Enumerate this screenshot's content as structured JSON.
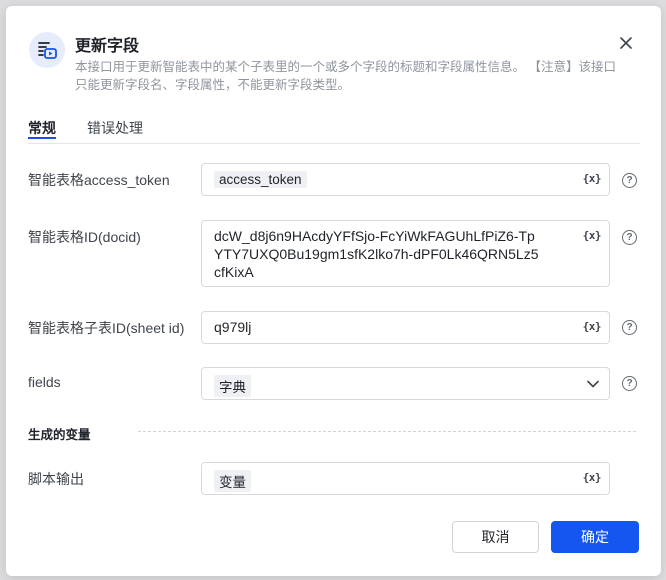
{
  "dialog": {
    "title": "更新字段",
    "description": "本接口用于更新智能表中的某个子表里的一个或多个字段的标题和字段属性信息。 【注意】该接口只能更新字段名、字段属性，不能更新字段类型。",
    "icon": "smart-sheet-icon",
    "close_icon": "close-icon"
  },
  "tabs": [
    {
      "label": "常规",
      "active": true
    },
    {
      "label": "错误处理",
      "active": false
    }
  ],
  "fields": {
    "access_token": {
      "label": "智能表格access_token",
      "value": "access_token",
      "var_icon": "{x}"
    },
    "docid": {
      "label": "智能表格ID(docid)",
      "value": "dcW_d8j6n9HAcdyYFfSjo-FcYiWkFAGUhLfPiZ6-TpYTY7UXQ0Bu19gm1sfK2lko7h-dPF0Lk46QRN5Lz5cfKixA",
      "var_icon": "{x}"
    },
    "sheet_id": {
      "label": "智能表格子表ID(sheet id)",
      "value": "q979lj",
      "var_icon": "{x}"
    },
    "fields": {
      "label": "fields",
      "value": "字典"
    }
  },
  "output": {
    "section_title": "生成的变量",
    "label": "脚本输出",
    "value": "变量",
    "var_icon": "{x}"
  },
  "help_glyph": "?",
  "buttons": {
    "cancel": "取消",
    "ok": "确定"
  },
  "colors": {
    "primary": "#1456f0",
    "tab_underline": "#1f4fe0",
    "icon_bg": "#e6ecfb"
  }
}
